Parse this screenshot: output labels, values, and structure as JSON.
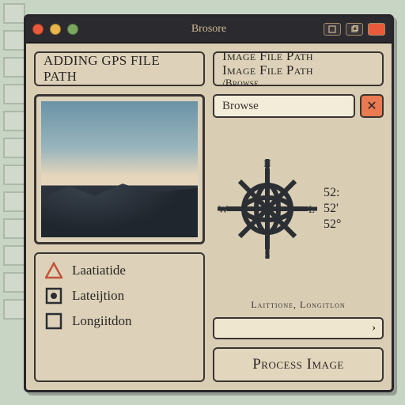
{
  "window": {
    "title": "Brosore"
  },
  "left_header": "Adding GPS File Path",
  "right_header": {
    "line1": "Image File Path",
    "line2": "Image File Path",
    "line3": "/Browse"
  },
  "browse": {
    "label": "Browse",
    "close_glyph": "✕"
  },
  "compass": {
    "n": "N",
    "s": "S",
    "e": "L",
    "w": "W"
  },
  "readouts": [
    "52:",
    "52'",
    "52°"
  ],
  "coord_label": "Laittione, Longitlon",
  "coord_value": "›",
  "list": [
    {
      "icon": "warning",
      "label": "Laatiatide"
    },
    {
      "icon": "target",
      "label": "Lateijtion"
    },
    {
      "icon": "square",
      "label": "Longiitdon"
    }
  ],
  "process_label": "Process Image"
}
